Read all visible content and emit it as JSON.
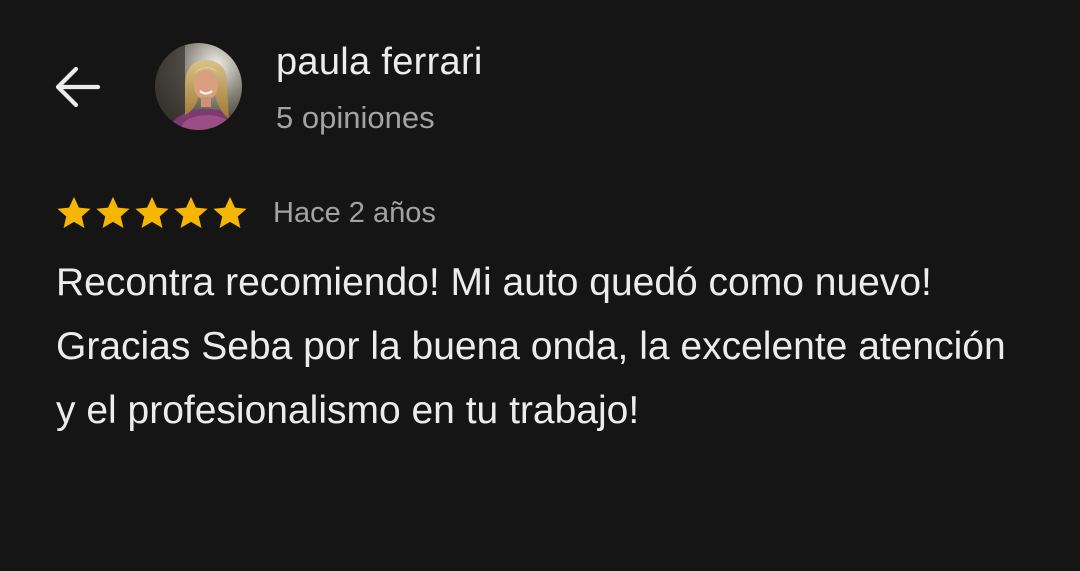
{
  "header": {
    "author_name": "paula ferrari",
    "review_count": "5 opiniones",
    "back_icon": "arrow-left-icon",
    "avatar_icon": "user-photo"
  },
  "review": {
    "rating": 5,
    "max_rating": 5,
    "date": "Hace 2 años",
    "text": "Recontra recomiendo! Mi auto quedó como nuevo! Gracias Seba por la buena onda, la excelente atención y el profesionalismo en tu trabajo!"
  },
  "colors": {
    "background": "#151515",
    "star": "#f6b500",
    "primary_text": "#ececec",
    "secondary_text": "#a3a3a3"
  }
}
